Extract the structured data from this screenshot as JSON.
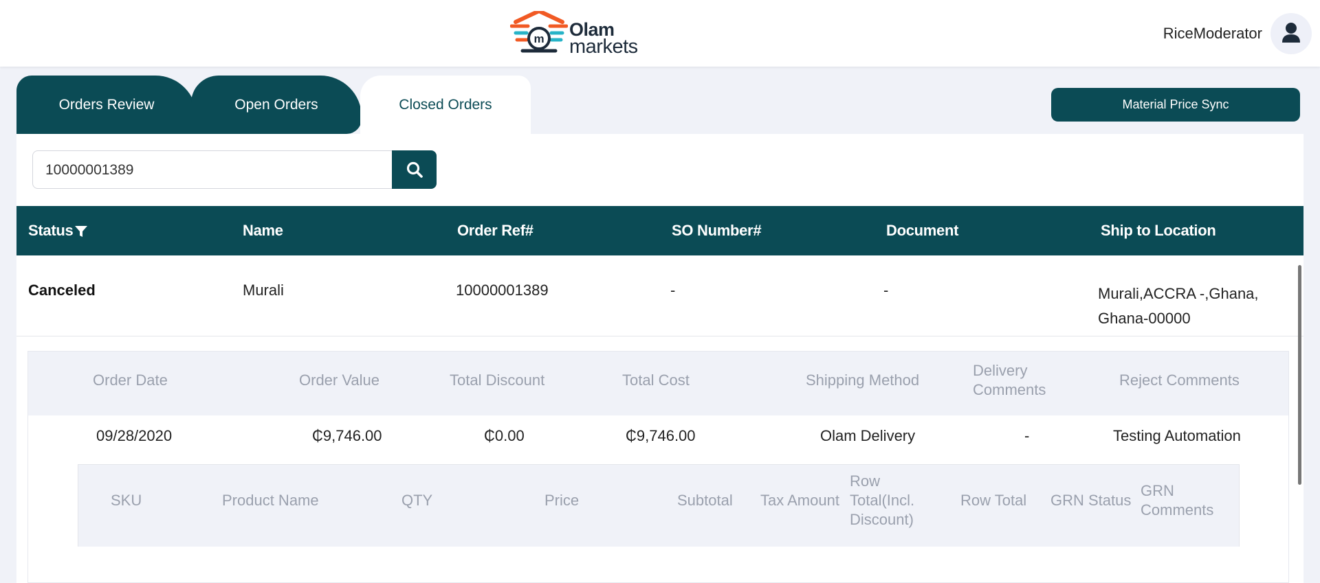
{
  "header": {
    "logo_line1": "Olam",
    "logo_line2": "markets",
    "username": "RiceModerator"
  },
  "tabs": [
    {
      "label": "Orders Review",
      "active": false
    },
    {
      "label": "Open Orders",
      "active": false
    },
    {
      "label": "Closed Orders",
      "active": true
    }
  ],
  "sync_button": "Material Price Sync",
  "search": {
    "value": "10000001389"
  },
  "table": {
    "columns": [
      "Status",
      "Name",
      "Order Ref#",
      "SO Number#",
      "Document",
      "Ship to Location"
    ],
    "rows": [
      {
        "status": "Canceled",
        "name": "Murali",
        "order_ref": "10000001389",
        "so_number": "-",
        "document": "-",
        "location_line1": "Murali,ACCRA -,Ghana,",
        "location_line2": "Ghana-00000"
      }
    ]
  },
  "details": {
    "columns": [
      "Order Date",
      "Order Value",
      "Total Discount",
      "Total Cost",
      "Shipping Method",
      "Delivery Comments",
      "Reject Comments"
    ],
    "values": [
      "09/28/2020",
      "₵9,746.00",
      "₵0.00",
      "₵9,746.00",
      "Olam Delivery",
      "-",
      "Testing Automation"
    ]
  },
  "items": {
    "columns": [
      "SKU",
      "Product Name",
      "QTY",
      "Price",
      "Subtotal",
      "Tax Amount",
      "Row Total(Incl. Discount)",
      "Row Total",
      "GRN Status",
      "GRN Comments"
    ]
  },
  "colors": {
    "primary": "#0b4b55",
    "background": "#f0f2f8",
    "logo_orange": "#f15a24",
    "logo_teal": "#27b3c7"
  }
}
